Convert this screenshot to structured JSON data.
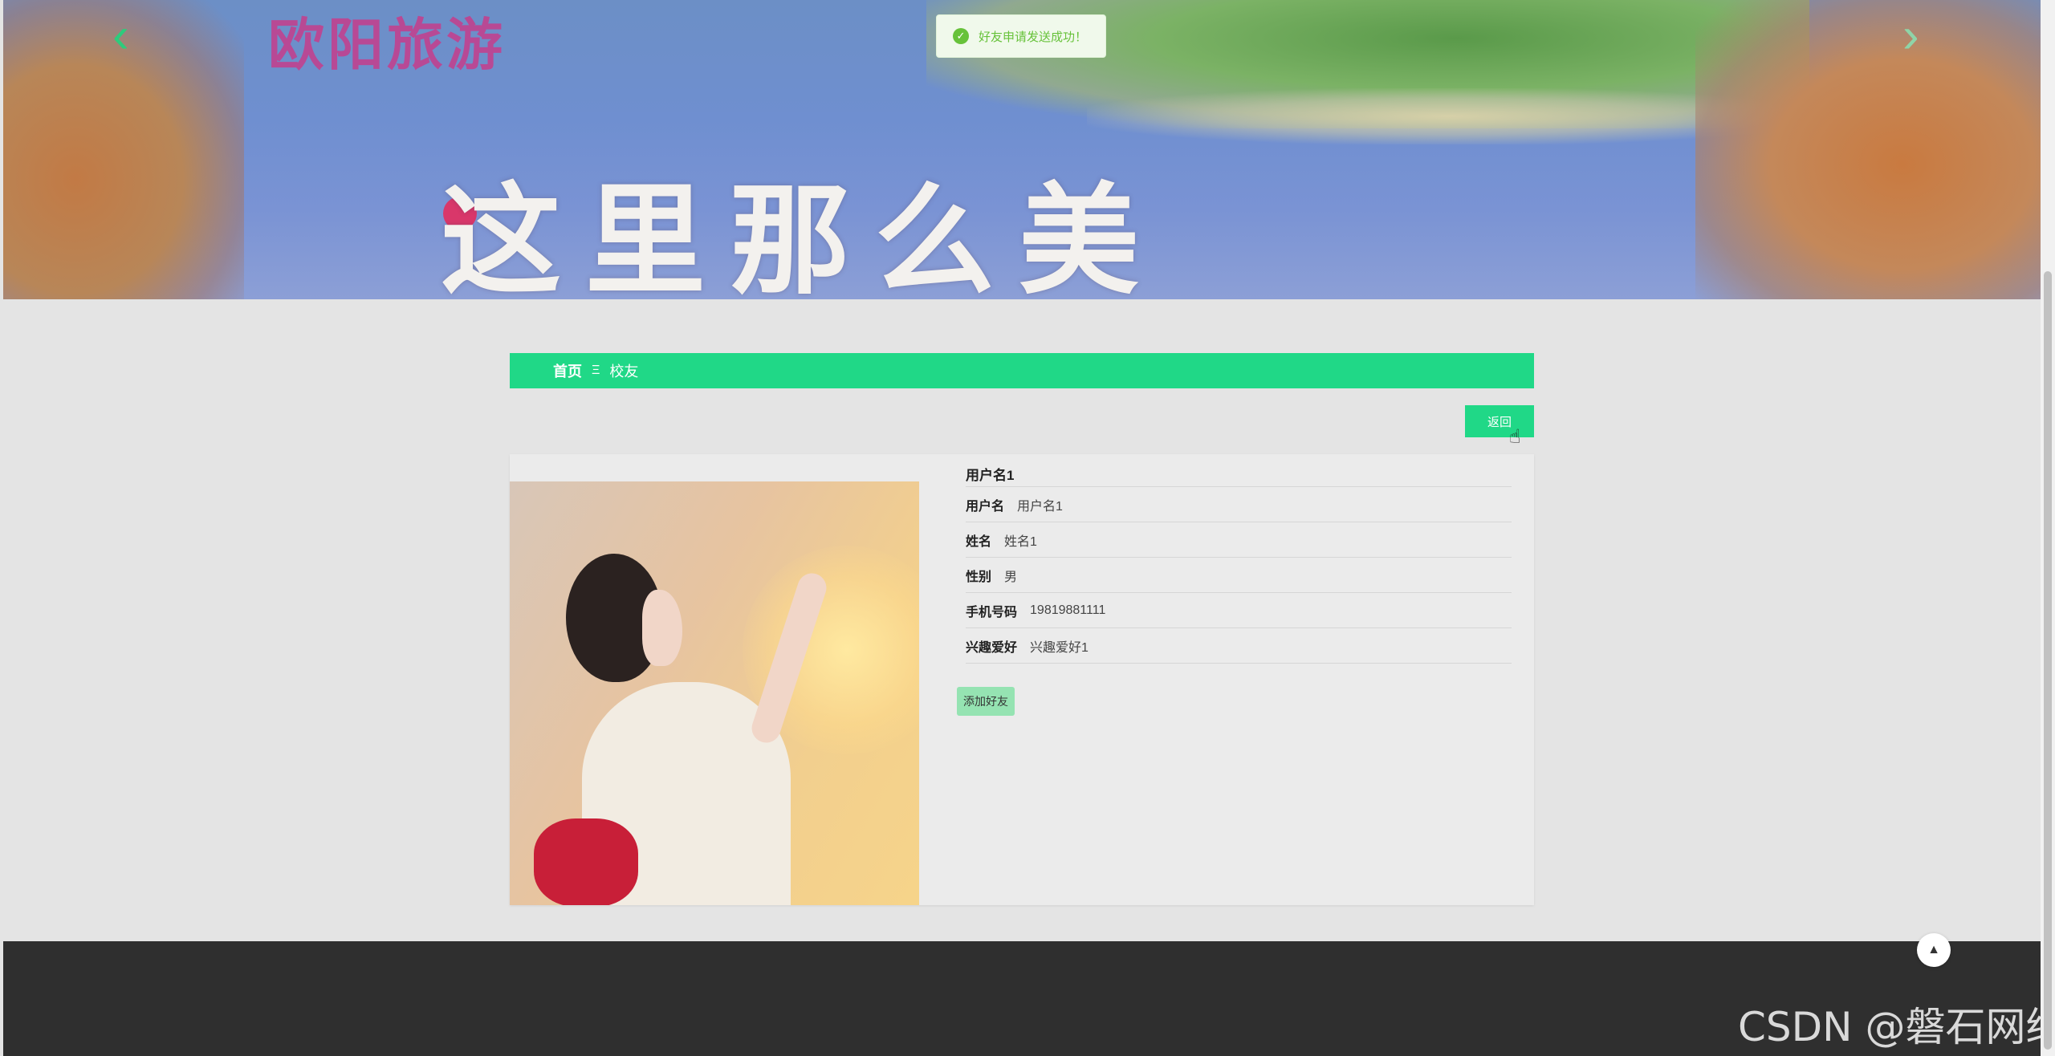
{
  "banner": {
    "title_top": "欧阳旅游",
    "title_big": "这里那么美",
    "prev_icon": "chevron-left-icon",
    "next_icon": "chevron-right-icon"
  },
  "toast": {
    "icon": "check-circle-icon",
    "message": "好友申请发送成功！",
    "color": "#67c23a"
  },
  "breadcrumb": {
    "home": "首页",
    "separator": "Ξ",
    "current": "校友"
  },
  "actions": {
    "back_label": "返回",
    "add_friend_label": "添加好友"
  },
  "profile": {
    "title": "用户名1",
    "fields": [
      {
        "label": "用户名",
        "value": "用户名1"
      },
      {
        "label": "姓名",
        "value": "姓名1"
      },
      {
        "label": "性别",
        "value": "男"
      },
      {
        "label": "手机号码",
        "value": "19819881111"
      },
      {
        "label": "兴趣爱好",
        "value": "兴趣爱好1"
      }
    ]
  },
  "footer": {
    "back_to_top_icon": "arrow-up-icon",
    "watermark": "CSDN @磐石网络"
  },
  "colors": {
    "accent": "#20d887",
    "add_button": "#95e3b2",
    "footer": "#2f2f2f"
  }
}
